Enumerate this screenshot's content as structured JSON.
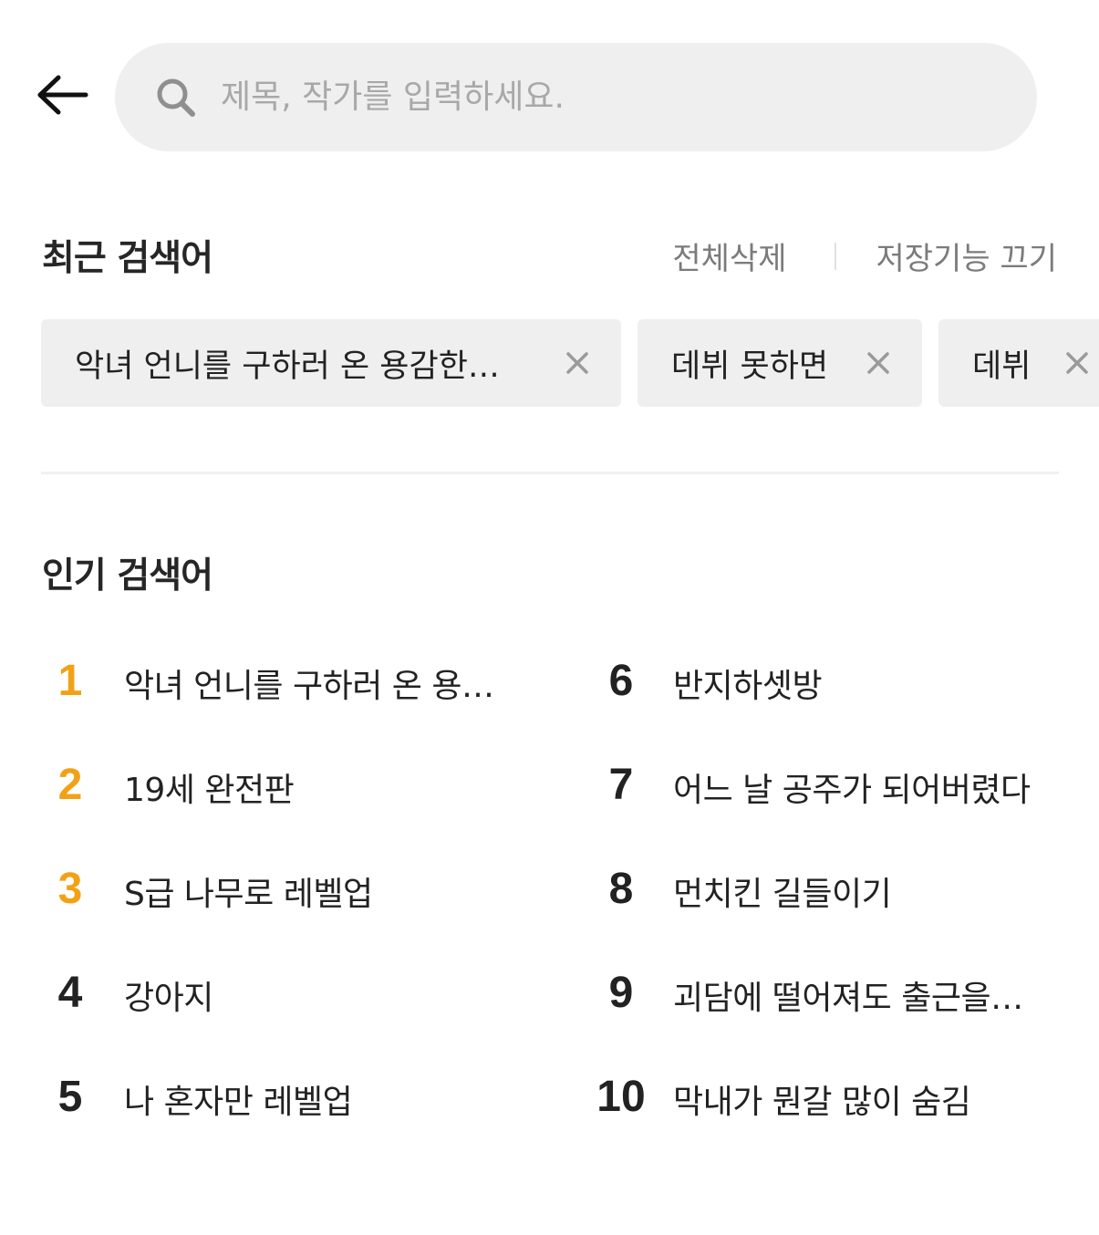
{
  "search": {
    "placeholder": "제목, 작가를 입력하세요."
  },
  "recent": {
    "title": "최근 검색어",
    "delete_all": "전체삭제",
    "disable_save": "저장기능 끄기",
    "chips": [
      {
        "label": "악녀 언니를 구하러 온 용감한…"
      },
      {
        "label": "데뷔 못하면"
      },
      {
        "label": "데뷔"
      }
    ]
  },
  "popular": {
    "title": "인기 검색어",
    "items": [
      {
        "rank": "1",
        "label": "악녀 언니를 구하러 온 용…"
      },
      {
        "rank": "2",
        "label": "19세 완전판"
      },
      {
        "rank": "3",
        "label": "S급 나무로 레벨업"
      },
      {
        "rank": "4",
        "label": "강아지"
      },
      {
        "rank": "5",
        "label": "나 혼자만 레벨업"
      },
      {
        "rank": "6",
        "label": "반지하셋방"
      },
      {
        "rank": "7",
        "label": "어느 날 공주가 되어버렸다"
      },
      {
        "rank": "8",
        "label": "먼치킨 길들이기"
      },
      {
        "rank": "9",
        "label": "괴담에 떨어져도 출근을…"
      },
      {
        "rank": "10",
        "label": "막내가 뭔갈 많이 숨김"
      }
    ]
  },
  "colors": {
    "accent_top_rank": "#f2a116",
    "search_bg": "#efefef",
    "chip_bg": "#efefef"
  },
  "icons": [
    "back-arrow-icon",
    "search-icon",
    "close-icon"
  ]
}
